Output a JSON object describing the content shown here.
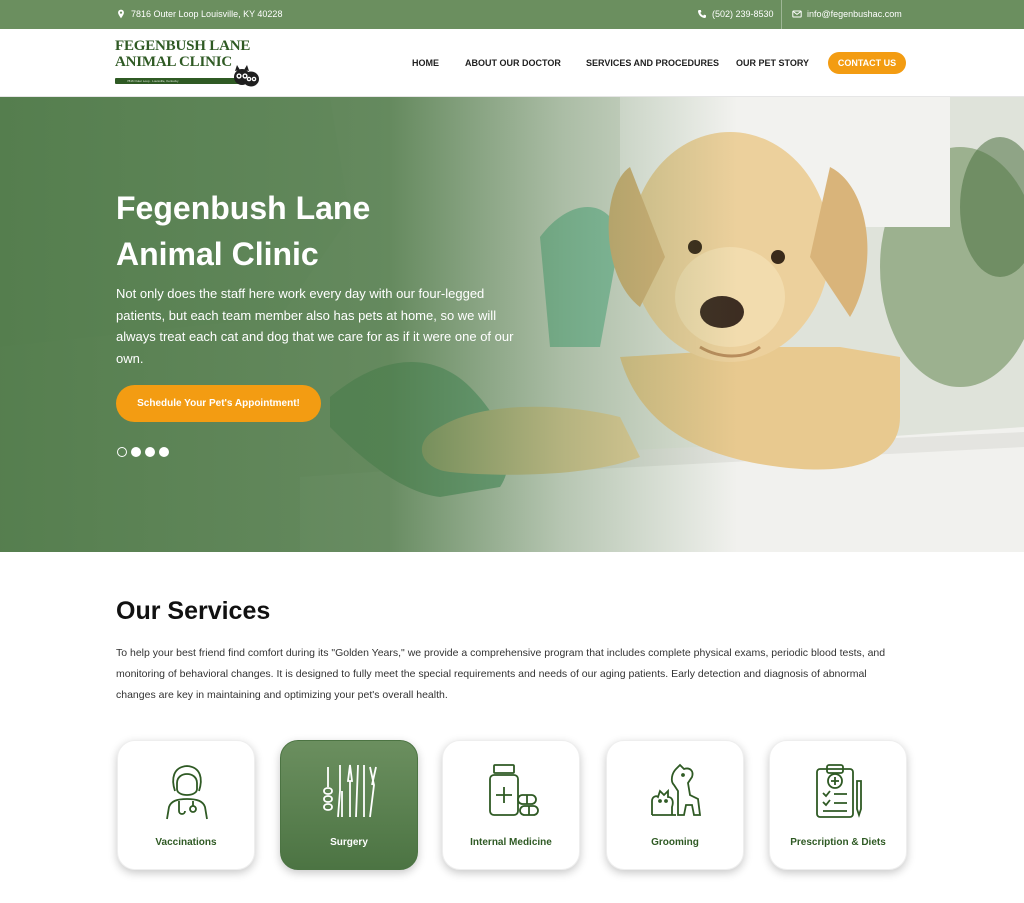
{
  "topbar": {
    "address": "7816 Outer Loop Louisville, KY 40228",
    "phone": "(502) 239-8530",
    "email": "info@fegenbushac.com"
  },
  "logo": {
    "line1": "FEGENBUSH LANE",
    "line2": "ANIMAL CLINIC",
    "tagline": "7816 Outer Loop · Louisville, Kentucky"
  },
  "nav": {
    "items": [
      {
        "label": "HOME"
      },
      {
        "label": "ABOUT OUR DOCTOR"
      },
      {
        "label": "SERVICES AND PROCEDURES"
      },
      {
        "label": "OUR PET STORY"
      }
    ],
    "contact": "CONTACT US"
  },
  "hero": {
    "title_line1": "Fegenbush Lane",
    "title_line2": "Animal Clinic",
    "text": "Not only does the staff here work every day with our four-legged patients, but each team member also has pets at home, so we will always treat each cat and dog that we care for as if it were one of our own.",
    "button": "Schedule Your Pet's Appointment!",
    "slides": 4,
    "active_slide": 1
  },
  "services": {
    "title": "Our Services",
    "text": "To help your best friend find comfort during its \"Golden Years,\" we provide a comprehensive program that includes complete physical exams, periodic blood tests, and monitoring of behavioral changes. It is designed to fully meet the special requirements and needs of our aging patients. Early detection and diagnosis of abnormal changes are key in maintaining and optimizing your pet's overall health.",
    "cards": [
      {
        "label": "Vaccinations",
        "icon": "veterinarian-icon"
      },
      {
        "label": "Surgery",
        "icon": "surgical-tools-icon"
      },
      {
        "label": "Internal Medicine",
        "icon": "medicine-bottle-icon"
      },
      {
        "label": "Grooming",
        "icon": "cat-and-dog-icon"
      },
      {
        "label": "Prescription & Diets",
        "icon": "clipboard-prescription-icon"
      }
    ]
  },
  "colors": {
    "brand_green": "#6b8f5f",
    "dark_green": "#2f5a24",
    "accent_orange": "#f39c12"
  }
}
